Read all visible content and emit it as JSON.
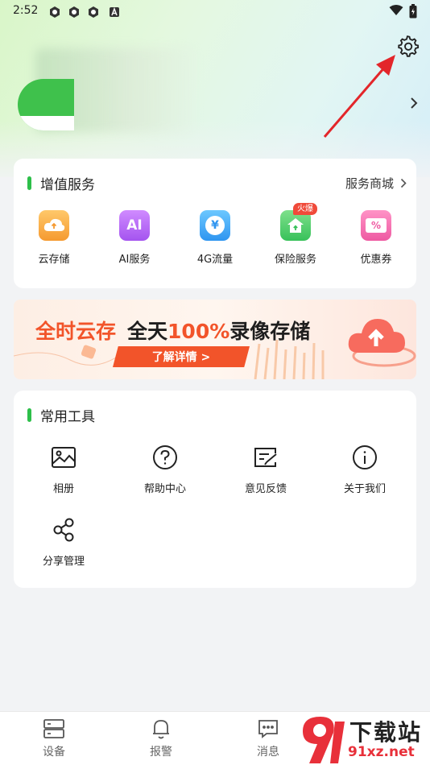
{
  "status_bar": {
    "time": "2:52"
  },
  "services": {
    "title": "增值服务",
    "mall_label": "服务商城",
    "items": [
      {
        "label": "云存储",
        "icon": "cloud-storage-icon",
        "color": "#f7a83a"
      },
      {
        "label": "AI服务",
        "icon": "ai-icon",
        "color": "#b366f0",
        "text": "AI"
      },
      {
        "label": "4G流量",
        "icon": "data-flow-icon",
        "color": "#3aa8f5",
        "text": "¥"
      },
      {
        "label": "保险服务",
        "icon": "insurance-icon",
        "color": "#4ccf6a",
        "badge": "火爆"
      },
      {
        "label": "优惠券",
        "icon": "coupon-icon",
        "color": "#f067a8",
        "text": "%"
      }
    ]
  },
  "banner": {
    "title_part1": "全时云存",
    "title_part2": "全天",
    "title_part3": "100%",
    "title_part4": "录像存储",
    "button": "了解详情 >"
  },
  "tools": {
    "title": "常用工具",
    "items": [
      {
        "label": "相册",
        "icon": "album-icon"
      },
      {
        "label": "帮助中心",
        "icon": "help-icon"
      },
      {
        "label": "意见反馈",
        "icon": "feedback-icon"
      },
      {
        "label": "关于我们",
        "icon": "info-icon"
      },
      {
        "label": "分享管理",
        "icon": "share-icon"
      }
    ]
  },
  "bottom_nav": [
    {
      "label": "设备",
      "icon": "device-icon"
    },
    {
      "label": "报警",
      "icon": "bell-icon"
    },
    {
      "label": "消息",
      "icon": "message-icon"
    }
  ],
  "watermark": {
    "title": "下载站",
    "site": "91xz.net"
  },
  "colors": {
    "accent": "#2dbf4a",
    "brand_orange": "#f2542a",
    "annotation": "#e3262a"
  }
}
